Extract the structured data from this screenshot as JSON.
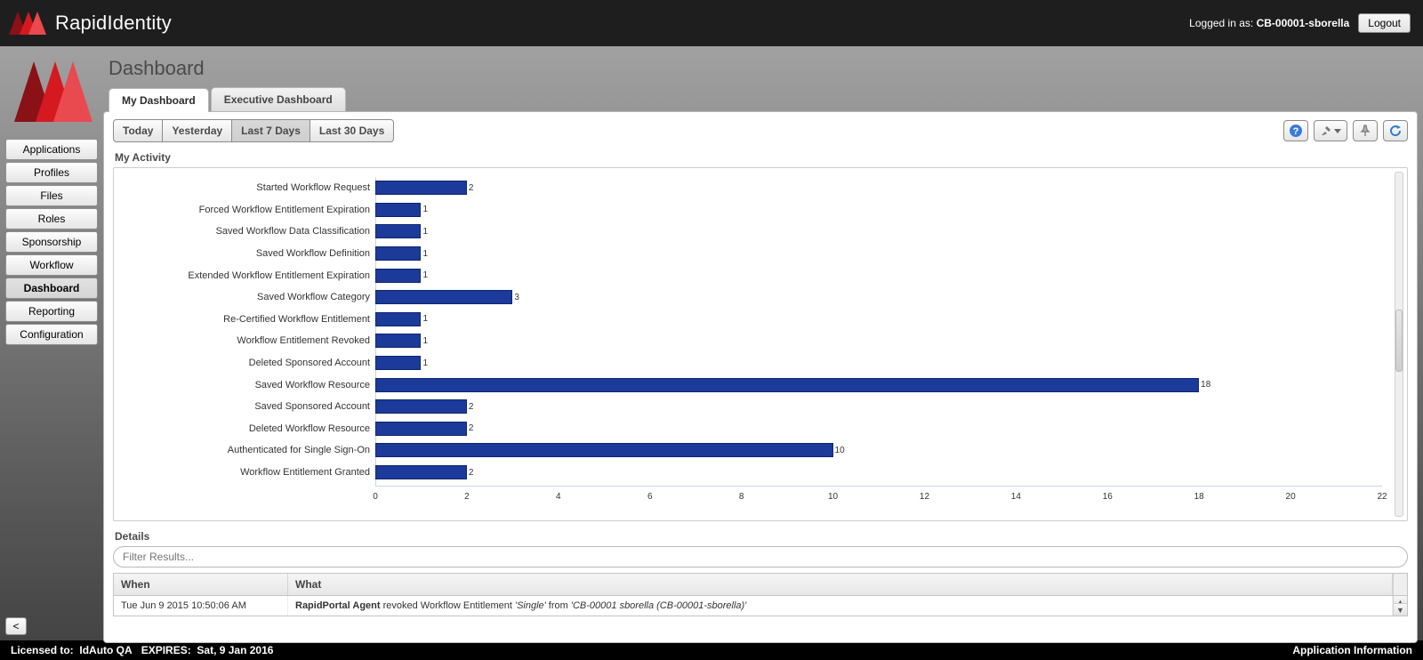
{
  "header": {
    "brand": "RapidIdentity",
    "logged_in_prefix": "Logged in as: ",
    "logged_in_user": "CB-00001-sborella",
    "logout_label": "Logout"
  },
  "sidebar": {
    "items": [
      {
        "label": "Applications"
      },
      {
        "label": "Profiles"
      },
      {
        "label": "Files"
      },
      {
        "label": "Roles"
      },
      {
        "label": "Sponsorship"
      },
      {
        "label": "Workflow"
      },
      {
        "label": "Dashboard"
      },
      {
        "label": "Reporting"
      },
      {
        "label": "Configuration"
      }
    ],
    "active_index": 6,
    "collapse_label": "<"
  },
  "page": {
    "title": "Dashboard",
    "tabs": [
      {
        "label": "My Dashboard"
      },
      {
        "label": "Executive Dashboard"
      }
    ],
    "active_tab": 0,
    "range_buttons": [
      {
        "label": "Today"
      },
      {
        "label": "Yesterday"
      },
      {
        "label": "Last 7 Days"
      },
      {
        "label": "Last 30 Days"
      }
    ],
    "active_range": 2,
    "activity_title": "My Activity",
    "details_title": "Details",
    "filter_placeholder": "Filter Results..."
  },
  "chart_data": {
    "type": "bar",
    "orientation": "horizontal",
    "title": "My Activity",
    "xlabel": "",
    "ylabel": "",
    "xlim": [
      0,
      22
    ],
    "x_ticks": [
      0,
      2,
      4,
      6,
      8,
      10,
      12,
      14,
      16,
      18,
      20,
      22
    ],
    "categories": [
      "Started Workflow Request",
      "Forced Workflow Entitlement Expiration",
      "Saved Workflow Data Classification",
      "Saved Workflow Definition",
      "Extended Workflow Entitlement Expiration",
      "Saved Workflow Category",
      "Re-Certified Workflow Entitlement",
      "Workflow Entitlement Revoked",
      "Deleted Sponsored Account",
      "Saved Workflow Resource",
      "Saved Sponsored Account",
      "Deleted Workflow Resource",
      "Authenticated for Single Sign-On",
      "Workflow Entitlement Granted"
    ],
    "values": [
      2,
      1,
      1,
      1,
      1,
      3,
      1,
      1,
      1,
      18,
      2,
      2,
      10,
      2
    ],
    "bar_color": "#1b3a9a"
  },
  "details_table": {
    "columns": [
      "When",
      "What"
    ],
    "rows": [
      {
        "when": "Tue Jun 9 2015 10:50:06 AM",
        "what_strong": "RapidPortal Agent",
        "what_mid": " revoked Workflow Entitlement ",
        "what_em1": "'Single'",
        "what_mid2": " from ",
        "what_em2": "'CB-00001 sborella (CB-00001-sborella)'"
      }
    ]
  },
  "footer": {
    "licensed_label": "Licensed to:",
    "licensed_value": "IdAuto QA",
    "expires_label": "EXPIRES:",
    "expires_value": "Sat, 9 Jan 2016",
    "app_info": "Application Information"
  },
  "colors": {
    "accent": "#c6171e",
    "bar": "#1b3a9a"
  }
}
